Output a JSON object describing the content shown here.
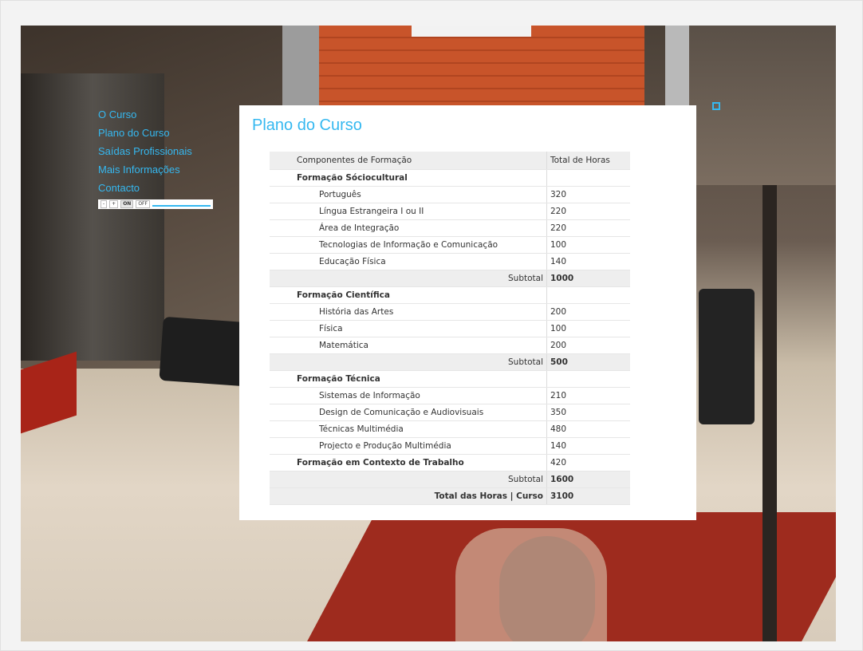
{
  "nav": {
    "items": [
      {
        "label": "O Curso"
      },
      {
        "label": "Plano do Curso"
      },
      {
        "label": "Saídas Profissionais"
      },
      {
        "label": "Mais Informações"
      },
      {
        "label": "Contacto"
      }
    ]
  },
  "player": {
    "prev": "-",
    "next": "+",
    "on": "ON",
    "off": "OFF"
  },
  "panel": {
    "title": "Plano do Curso",
    "table": {
      "headers": [
        "Componentes de Formação",
        "Total de Horas"
      ],
      "rows": [
        {
          "type": "group",
          "name": "Formação Sóciocultural",
          "hours": ""
        },
        {
          "type": "item",
          "name": "Português",
          "hours": "320"
        },
        {
          "type": "item",
          "name": "Língua Estrangeira I ou II",
          "hours": "220"
        },
        {
          "type": "item",
          "name": "Área de Integração",
          "hours": "220"
        },
        {
          "type": "item",
          "name": "Tecnologias de Informação e Comunicação",
          "hours": "100"
        },
        {
          "type": "item",
          "name": "Educação Física",
          "hours": "140"
        },
        {
          "type": "subtotal",
          "name": "Subtotal",
          "hours": "1000"
        },
        {
          "type": "group",
          "name": "Formação Científica",
          "hours": ""
        },
        {
          "type": "item",
          "name": "História das Artes",
          "hours": "200"
        },
        {
          "type": "item",
          "name": "Física",
          "hours": "100"
        },
        {
          "type": "item",
          "name": "Matemática",
          "hours": "200"
        },
        {
          "type": "subtotal",
          "name": "Subtotal",
          "hours": "500"
        },
        {
          "type": "group",
          "name": "Formação Técnica",
          "hours": ""
        },
        {
          "type": "item",
          "name": "Sistemas de Informação",
          "hours": "210"
        },
        {
          "type": "item",
          "name": "Design de Comunicação e Audiovisuais",
          "hours": "350"
        },
        {
          "type": "item",
          "name": "Técnicas Multimédia",
          "hours": "480"
        },
        {
          "type": "item",
          "name": "Projecto e Produção Multimédia",
          "hours": "140"
        },
        {
          "type": "group",
          "name": "Formação em Contexto de Trabalho",
          "hours": "420"
        },
        {
          "type": "subtotal",
          "name": "Subtotal",
          "hours": "1600"
        },
        {
          "type": "total",
          "name": "Total das Horas | Curso",
          "hours": "3100"
        }
      ]
    }
  },
  "colors": {
    "accent": "#35b8f0",
    "panel_bg": "#ffffff",
    "row_shade": "#eeeeee"
  },
  "icons": {
    "expand": "expand-icon"
  }
}
